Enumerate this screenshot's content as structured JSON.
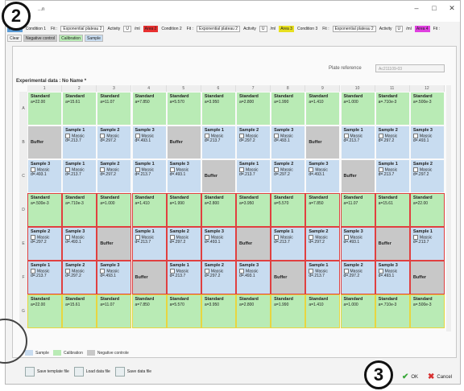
{
  "window": {
    "title": "...n",
    "minimize": "–",
    "maximize": "□",
    "close": "✕"
  },
  "badges": {
    "top": "2",
    "bottom": "3"
  },
  "areas": [
    {
      "label": "Area 1",
      "color": "#5b9bd5",
      "condition": "Condition 1",
      "fit": "Fit :",
      "model": "Exponential plateau 2",
      "activity": "Activity",
      "unit": "U",
      "in": "/ml"
    },
    {
      "label": "Area 2",
      "color": "#e83030",
      "condition": "Condition 2",
      "fit": "Fit :",
      "model": "Exponential plateau 2",
      "activity": "Activity",
      "unit": "U",
      "in": "/ml"
    },
    {
      "label": "Area 3",
      "color": "#e8e020",
      "condition": "Condition 3",
      "fit": "Fit :",
      "model": "Exponential plateau 2",
      "activity": "Activity",
      "unit": "U",
      "in": "/ml"
    },
    {
      "label": "Area 4",
      "color": "#e040e0",
      "condition": "",
      "fit": "Fit :",
      "model": "",
      "activity": "",
      "unit": "",
      "in": ""
    }
  ],
  "tags": [
    {
      "label": "Clear",
      "color": "#f4f4f4"
    },
    {
      "label": "Negative control",
      "color": "#c8c8c8"
    },
    {
      "label": "Calibration",
      "color": "#b9ebb5"
    },
    {
      "label": "Sample",
      "color": "#c8dcf0"
    }
  ],
  "plate_reference": {
    "label": "Plate reference",
    "value": "Ac211109-03"
  },
  "experimental_title": "Experimental data : No Name *",
  "columns": [
    "1",
    "2",
    "3",
    "4",
    "5",
    "6",
    "7",
    "8",
    "9",
    "10",
    "11",
    "12"
  ],
  "rows": [
    {
      "letter": "A",
      "cells": [
        {
          "type": "std",
          "name": "Standard",
          "sub": "a=22.00"
        },
        {
          "type": "std",
          "name": "Standard",
          "sub": "a=15.61"
        },
        {
          "type": "std",
          "name": "Standard",
          "sub": "a=11.07"
        },
        {
          "type": "std",
          "name": "Standard",
          "sub": "a=7.850"
        },
        {
          "type": "std",
          "name": "Standard",
          "sub": "a=5.570"
        },
        {
          "type": "std",
          "name": "Standard",
          "sub": "a=3.950"
        },
        {
          "type": "std",
          "name": "Standard",
          "sub": "a=2.800"
        },
        {
          "type": "std",
          "name": "Standard",
          "sub": "a=1.990"
        },
        {
          "type": "std",
          "name": "Standard",
          "sub": "a=1.410"
        },
        {
          "type": "std",
          "name": "Standard",
          "sub": "a=1.000"
        },
        {
          "type": "std",
          "name": "Standard",
          "sub": "a=.710e-3"
        },
        {
          "type": "std",
          "name": "Standard",
          "sub": "a=.500e-3"
        }
      ]
    },
    {
      "letter": "B",
      "cells": [
        {
          "type": "buf",
          "name": "Buffer"
        },
        {
          "type": "smp",
          "name": "Sample 1",
          "mass": "Massic",
          "sub": "d=.213.7"
        },
        {
          "type": "smp",
          "name": "Sample 2",
          "mass": "Massic",
          "sub": "d=.297.2"
        },
        {
          "type": "smp",
          "name": "Sample 3",
          "mass": "Massic",
          "sub": "d=.493.1"
        },
        {
          "type": "buf",
          "name": "Buffer"
        },
        {
          "type": "smp",
          "name": "Sample 1",
          "mass": "Massic",
          "sub": "d=.213.7"
        },
        {
          "type": "smp",
          "name": "Sample 2",
          "mass": "Massic",
          "sub": "d=.297.2"
        },
        {
          "type": "smp",
          "name": "Sample 3",
          "mass": "Massic",
          "sub": "d=.493.1"
        },
        {
          "type": "buf",
          "name": "Buffer"
        },
        {
          "type": "smp",
          "name": "Sample 1",
          "mass": "Massic",
          "sub": "d=.213.7"
        },
        {
          "type": "smp",
          "name": "Sample 2",
          "mass": "Massic",
          "sub": "d=.297.2"
        },
        {
          "type": "smp",
          "name": "Sample 3",
          "mass": "Massic",
          "sub": "d=.493.1"
        }
      ]
    },
    {
      "letter": "C",
      "cells": [
        {
          "type": "smp",
          "name": "Sample 3",
          "mass": "Massic",
          "sub": "d=.493.1"
        },
        {
          "type": "smp",
          "name": "Sample 1",
          "mass": "Massic",
          "sub": "d=.213.7"
        },
        {
          "type": "smp",
          "name": "Sample 2",
          "mass": "Massic",
          "sub": "d=.297.2"
        },
        {
          "type": "smp",
          "name": "Sample 1",
          "mass": "Massic",
          "sub": "d=.213.7"
        },
        {
          "type": "smp",
          "name": "Sample 3",
          "mass": "Massic",
          "sub": "d=.493.1"
        },
        {
          "type": "buf",
          "name": "Buffer"
        },
        {
          "type": "smp",
          "name": "Sample 1",
          "mass": "Massic",
          "sub": "d=.213.7"
        },
        {
          "type": "smp",
          "name": "Sample 2",
          "mass": "Massic",
          "sub": "d=.297.2"
        },
        {
          "type": "smp",
          "name": "Sample 3",
          "mass": "Massic",
          "sub": "d=.493.1"
        },
        {
          "type": "buf",
          "name": "Buffer"
        },
        {
          "type": "smp",
          "name": "Sample 1",
          "mass": "Massic",
          "sub": "d=.213.7"
        },
        {
          "type": "smp",
          "name": "Sample 2",
          "mass": "Massic",
          "sub": "d=.297.2"
        }
      ]
    },
    {
      "letter": "D",
      "border": "red",
      "cells": [
        {
          "type": "std",
          "name": "Standard",
          "sub": "a=.500e-3"
        },
        {
          "type": "std",
          "name": "Standard",
          "sub": "a=.710e-3"
        },
        {
          "type": "std",
          "name": "Standard",
          "sub": "a=1.000"
        },
        {
          "type": "std",
          "name": "Standard",
          "sub": "a=1.410"
        },
        {
          "type": "std",
          "name": "Standard",
          "sub": "a=1.990"
        },
        {
          "type": "std",
          "name": "Standard",
          "sub": "a=2.800"
        },
        {
          "type": "std",
          "name": "Standard",
          "sub": "a=3.950"
        },
        {
          "type": "std",
          "name": "Standard",
          "sub": "a=5.570"
        },
        {
          "type": "std",
          "name": "Standard",
          "sub": "a=7.850"
        },
        {
          "type": "std",
          "name": "Standard",
          "sub": "a=11.07"
        },
        {
          "type": "std",
          "name": "Standard",
          "sub": "a=15.61"
        },
        {
          "type": "std",
          "name": "Standard",
          "sub": "a=22.00"
        }
      ]
    },
    {
      "letter": "E",
      "border": "red",
      "cells": [
        {
          "type": "smp",
          "name": "Sample 2",
          "mass": "Massic",
          "sub": "d=.297.2"
        },
        {
          "type": "smp",
          "name": "Sample 3",
          "mass": "Massic",
          "sub": "d=.493.1"
        },
        {
          "type": "buf",
          "name": "Buffer"
        },
        {
          "type": "smp",
          "name": "Sample 1",
          "mass": "Massic",
          "sub": "d=.213.7"
        },
        {
          "type": "smp",
          "name": "Sample 2",
          "mass": "Massic",
          "sub": "d=.297.2"
        },
        {
          "type": "smp",
          "name": "Sample 3",
          "mass": "Massic",
          "sub": "d=.493.1"
        },
        {
          "type": "buf",
          "name": "Buffer"
        },
        {
          "type": "smp",
          "name": "Sample 1",
          "mass": "Massic",
          "sub": "d=.213.7"
        },
        {
          "type": "smp",
          "name": "Sample 2",
          "mass": "Massic",
          "sub": "d=.297.2"
        },
        {
          "type": "smp",
          "name": "Sample 3",
          "mass": "Massic",
          "sub": "d=.493.1"
        },
        {
          "type": "buf",
          "name": "Buffer"
        },
        {
          "type": "smp",
          "name": "Sample 1",
          "mass": "Massic",
          "sub": "d=.213.7"
        }
      ]
    },
    {
      "letter": "F",
      "border": "red",
      "cells": [
        {
          "type": "smp",
          "name": "Sample 1",
          "mass": "Massic",
          "sub": "d=.213.7"
        },
        {
          "type": "smp",
          "name": "Sample 2",
          "mass": "Massic",
          "sub": "d=.297.2"
        },
        {
          "type": "smp",
          "name": "Sample 3",
          "mass": "Massic",
          "sub": "d=.493.1"
        },
        {
          "type": "buf",
          "name": "Buffer"
        },
        {
          "type": "smp",
          "name": "Sample 1",
          "mass": "Massic",
          "sub": "d=.213.7"
        },
        {
          "type": "smp",
          "name": "Sample 2",
          "mass": "Massic",
          "sub": "d=.297.2"
        },
        {
          "type": "smp",
          "name": "Sample 3",
          "mass": "Massic",
          "sub": "d=.493.1"
        },
        {
          "type": "buf",
          "name": "Buffer"
        },
        {
          "type": "smp",
          "name": "Sample 1",
          "mass": "Massic",
          "sub": "d=.213.7"
        },
        {
          "type": "smp",
          "name": "Sample 2",
          "mass": "Massic",
          "sub": "d=.297.2"
        },
        {
          "type": "smp",
          "name": "Sample 3",
          "mass": "Massic",
          "sub": "d=.493.1"
        },
        {
          "type": "buf",
          "name": "Buffer"
        }
      ]
    },
    {
      "letter": "G",
      "border": "yellow",
      "cells": [
        {
          "type": "std",
          "name": "Standard",
          "sub": "a=22.00"
        },
        {
          "type": "std",
          "name": "Standard",
          "sub": "a=15.61"
        },
        {
          "type": "std",
          "name": "Standard",
          "sub": "a=11.07"
        },
        {
          "type": "std",
          "name": "Standard",
          "sub": "a=7.850"
        },
        {
          "type": "std",
          "name": "Standard",
          "sub": "a=5.570"
        },
        {
          "type": "std",
          "name": "Standard",
          "sub": "a=3.950"
        },
        {
          "type": "std",
          "name": "Standard",
          "sub": "a=2.800"
        },
        {
          "type": "std",
          "name": "Standard",
          "sub": "a=1.990"
        },
        {
          "type": "std",
          "name": "Standard",
          "sub": "a=1.410"
        },
        {
          "type": "std",
          "name": "Standard",
          "sub": "a=1.000"
        },
        {
          "type": "std",
          "name": "Standard",
          "sub": "a=.710e-3"
        },
        {
          "type": "std",
          "name": "Standard",
          "sub": "a=.500e-3"
        }
      ]
    }
  ],
  "legend": [
    {
      "label": "Sample",
      "color": "#c8dcf0"
    },
    {
      "label": "Calibration",
      "color": "#b9ebb5"
    },
    {
      "label": "Negative controle",
      "color": "#c8c8c8"
    }
  ],
  "buttons": {
    "save_template": "Save template file",
    "load_data": "Load data file",
    "save_data": "Save data file",
    "ok": "OK",
    "cancel": "Cancel"
  }
}
